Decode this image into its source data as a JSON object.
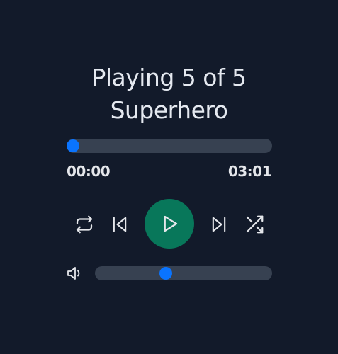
{
  "now_playing": {
    "position_text": "Playing 5 of 5",
    "track_title": "Superhero"
  },
  "progress": {
    "current_time": "00:00",
    "total_time": "03:01",
    "fraction": 0.03
  },
  "controls": {
    "repeat_icon": "repeat-icon",
    "previous_icon": "skip-previous-icon",
    "play_icon": "play-icon",
    "next_icon": "skip-next-icon",
    "shuffle_icon": "shuffle-icon"
  },
  "volume": {
    "icon": "volume-icon",
    "fraction": 0.4
  },
  "colors": {
    "background": "#121a2a",
    "track": "#374151",
    "accent": "#0a74ff",
    "play_button": "#08775a",
    "text": "#e5e7eb"
  }
}
